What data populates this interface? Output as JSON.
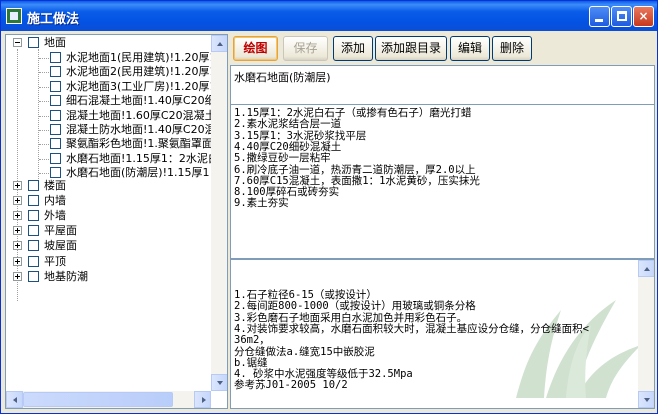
{
  "window": {
    "title": "施工做法",
    "minimize_label": "_",
    "maximize_label": "□",
    "close_label": "×"
  },
  "tree": {
    "root_label": "地面",
    "root_children": [
      "水泥地面1(民用建筑)!1.20厚1",
      "水泥地面2(民用建筑)!1.20厚1",
      "水泥地面3(工业厂房)!1.20厚1",
      "细石混凝土地面!1.40厚C20细石",
      "混凝土地面!1.60厚C20混凝土",
      "混凝土防水地面!1.40厚C20混凝",
      "聚氨酯彩色地面!1.聚氨酯罩面",
      "水磨石地面!1.15厚1：2水泥白",
      "水磨石地面(防潮层)!1.15厚1：2"
    ],
    "categories": [
      "楼面",
      "内墙",
      "外墙",
      "平屋面",
      "坡屋面",
      "平顶",
      "地基防潮"
    ]
  },
  "toolbar": {
    "draw": "绘图",
    "save": "保存",
    "add": "添加",
    "add_with_dir": "添加跟目录",
    "edit": "编辑",
    "delete": "删除"
  },
  "detail": {
    "name": "水磨石地面(防潮层)",
    "steps": [
      "1.15厚1：2水泥白石子（或掺有色石子）磨光打蜡",
      "2.素水泥浆结合层一道",
      "3.15厚1：3水泥砂浆找平层",
      "4.40厚C20细砂混凝土",
      "5.撒绿豆砂一层粘牢",
      "6.刷冷底子油一道，热沥青二道防潮层，厚2.0以上",
      "7.60厚C15混凝土，表面撒1：1水泥黄砂，压实抹光",
      "8.100厚碎石或砖夯实",
      "9.素土夯实"
    ],
    "notes": [
      "1.石子粒径6-15（或按设计）",
      "2.每间距800-1000（或按设计）用玻璃或铜条分格",
      "3.彩色磨石子地面采用白水泥加色并用彩色石子。",
      "4.对装饰要求较高，水磨石面积较大时，混凝土基应设分仓缝，分仓缝面积<",
      "36m2，",
      "分仓缝做法a.缝宽15中嵌胶泥",
      "        b.锯缝",
      "4.     砂浆中水泥强度等级低于32.5Mpa",
      "参考苏J01-2005 10/2"
    ]
  }
}
